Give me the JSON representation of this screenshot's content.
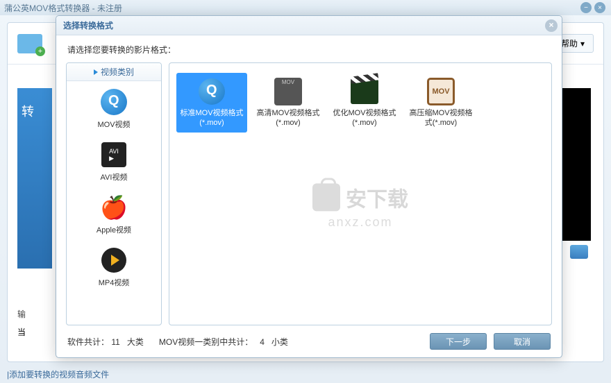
{
  "window": {
    "title": "蒲公英MOV格式转换器 - 未注册"
  },
  "toolbar": {
    "help_label": "帮助"
  },
  "banner": {
    "heading": "转"
  },
  "output": {
    "label1": "输",
    "label2": "当"
  },
  "status": {
    "tip": "添加要转换的视频音频文件"
  },
  "modal": {
    "title": "选择转换格式",
    "instruction": "请选择您要转换的影片格式：",
    "category_header": "视频类别",
    "categories": [
      {
        "id": "mov",
        "label": "MOV视频"
      },
      {
        "id": "avi",
        "label": "AVI视频"
      },
      {
        "id": "apple",
        "label": "Apple视频"
      },
      {
        "id": "mp4",
        "label": "MP4视频"
      }
    ],
    "formats": [
      {
        "id": "std",
        "label": "标准MOV视频格式(*.mov)",
        "selected": true
      },
      {
        "id": "hd",
        "label": "高清MOV视频格式(*.mov)",
        "selected": false
      },
      {
        "id": "opt",
        "label": "优化MOV视频格式(*.mov)",
        "selected": false
      },
      {
        "id": "comp",
        "label": "高压缩MOV视频格式(*.mov)",
        "selected": false
      }
    ],
    "watermark_main": "安下载",
    "watermark_sub": "anxz.com",
    "footer": {
      "total_label": "软件共计：",
      "total_count": "11",
      "total_unit": "大类",
      "sub_label": "MOV视频一类别中共计：",
      "sub_count": "4",
      "sub_unit": "小类"
    },
    "buttons": {
      "next": "下一步",
      "cancel": "取消"
    }
  }
}
